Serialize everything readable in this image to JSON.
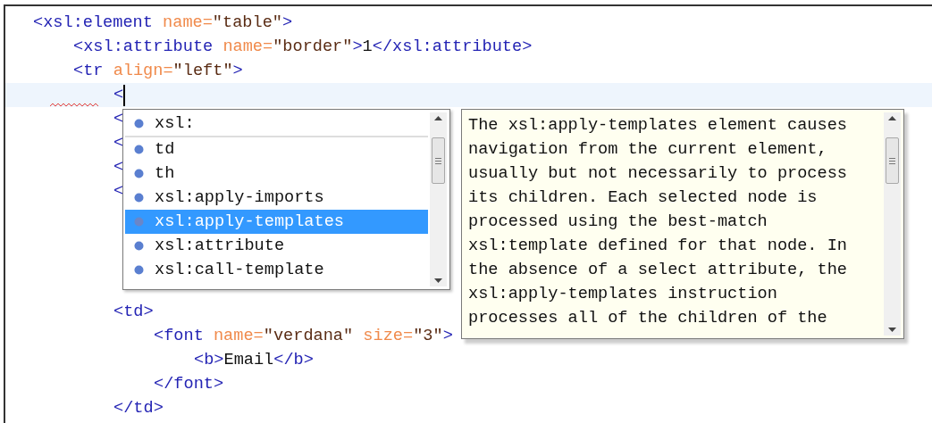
{
  "editor": {
    "lines": [
      {
        "current": false,
        "error": false,
        "tokens": [
          {
            "kind": "tag",
            "text": "<xsl:element "
          },
          {
            "kind": "attr",
            "text": "name="
          },
          {
            "kind": "value",
            "text": "\"table\""
          },
          {
            "kind": "tag",
            "text": ">"
          }
        ],
        "children": [
          {
            "current": false,
            "error": false,
            "tokens": [
              {
                "kind": "tag",
                "text": "<xsl:attribute "
              },
              {
                "kind": "attr",
                "text": "name="
              },
              {
                "kind": "value",
                "text": "\"border\""
              },
              {
                "kind": "tag",
                "text": ">"
              },
              {
                "kind": "text",
                "text": "1"
              },
              {
                "kind": "tag",
                "text": "</xsl:attribute>"
              }
            ]
          },
          {
            "current": false,
            "error": false,
            "tokens": [
              {
                "kind": "tag",
                "text": "<tr "
              },
              {
                "kind": "attr",
                "text": "align="
              },
              {
                "kind": "value",
                "text": "\"left\""
              },
              {
                "kind": "tag",
                "text": ">"
              }
            ],
            "children": [
              {
                "current": true,
                "error": true,
                "tokens": [
                  {
                    "kind": "tag",
                    "text": "<"
                  }
                ]
              },
              {
                "current": false,
                "error": false,
                "tokens": [
                  {
                    "kind": "tag",
                    "text": "<"
                  }
                ]
              },
              {
                "current": false,
                "error": false,
                "tokens": [
                  {
                    "kind": "tag",
                    "text": "<"
                  }
                ]
              },
              {
                "current": false,
                "error": false,
                "tokens": [
                  {
                    "kind": "tag",
                    "text": "<"
                  }
                ]
              },
              {
                "current": false,
                "error": false,
                "tokens": [
                  {
                    "kind": "tag",
                    "text": "<"
                  }
                ]
              },
              {
                "current": false,
                "error": false
              },
              {
                "current": false,
                "error": false
              },
              {
                "current": false,
                "error": false
              },
              {
                "current": false,
                "error": false
              },
              {
                "current": false,
                "error": false,
                "tokens": [
                  {
                    "kind": "tag",
                    "text": "<td>"
                  }
                ],
                "children": [
                  {
                    "current": false,
                    "error": false,
                    "tokens": [
                      {
                        "kind": "tag",
                        "text": "<font "
                      },
                      {
                        "kind": "attr",
                        "text": "name="
                      },
                      {
                        "kind": "value",
                        "text": "\"verdana\" "
                      },
                      {
                        "kind": "attr",
                        "text": "size="
                      },
                      {
                        "kind": "value",
                        "text": "\"3\""
                      },
                      {
                        "kind": "tag",
                        "text": ">"
                      }
                    ],
                    "children": [
                      {
                        "current": false,
                        "error": false,
                        "tokens": [
                          {
                            "kind": "tag",
                            "text": "<b>"
                          },
                          {
                            "kind": "text",
                            "text": "Email"
                          },
                          {
                            "kind": "tag",
                            "text": "</b>"
                          }
                        ]
                      }
                    ]
                  },
                  {
                    "current": false,
                    "error": false,
                    "tokens": [
                      {
                        "kind": "tag",
                        "text": "</font>"
                      }
                    ]
                  }
                ]
              },
              {
                "current": false,
                "error": false,
                "tokens": [
                  {
                    "kind": "tag",
                    "text": "</td>"
                  }
                ]
              }
            ]
          }
        ]
      }
    ]
  },
  "completion": {
    "items": [
      {
        "label": "xsl:",
        "selected": false
      },
      {
        "label": "td",
        "selected": false
      },
      {
        "label": "th",
        "selected": false
      },
      {
        "label": "xsl:apply-imports",
        "selected": false
      },
      {
        "label": "xsl:apply-templates",
        "selected": true
      },
      {
        "label": "xsl:attribute",
        "selected": false
      },
      {
        "label": "xsl:call-template",
        "selected": false
      }
    ]
  },
  "documentation": {
    "lines": [
      "The xsl:apply-templates element causes",
      "navigation from the current element,",
      "usually but not necessarily to process",
      "its children. Each selected node is",
      "processed using the best-match",
      "xsl:template defined for that node. In",
      "the absence of a select attribute, the",
      "xsl:apply-templates instruction",
      "processes all of the children of the"
    ]
  }
}
